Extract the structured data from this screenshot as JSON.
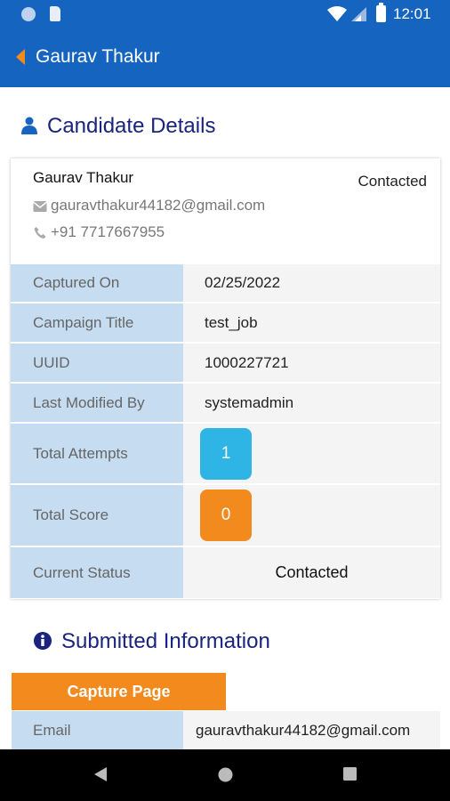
{
  "status_bar": {
    "time": "12:01"
  },
  "app_bar": {
    "title": "Gaurav Thakur",
    "back_icon": "back-arrow-icon",
    "accent_color": "#1565C0",
    "back_color": "#f28a1e"
  },
  "candidate_section": {
    "title": "Candidate Details",
    "icon": "user-icon",
    "name": "Gaurav Thakur",
    "status": "Contacted",
    "email": "gauravthakur44182@gmail.com",
    "phone": "+91 7717667955",
    "details": [
      {
        "label": "Captured On",
        "value": "02/25/2022"
      },
      {
        "label": "Campaign Title",
        "value": "test_job"
      },
      {
        "label": "UUID",
        "value": "1000227721"
      },
      {
        "label": "Last Modified By",
        "value": "systemadmin"
      },
      {
        "label": "Total Attempts",
        "value": "1"
      },
      {
        "label": "Total Score",
        "value": "0"
      },
      {
        "label": "Current Status",
        "value": "Contacted"
      }
    ]
  },
  "submitted_section": {
    "title": "Submitted Information",
    "icon": "info-icon",
    "tab_label": "Capture Page",
    "rows": [
      {
        "label": "Email",
        "value": "gauravthakur44182@gmail.com"
      }
    ]
  },
  "colors": {
    "header_blue": "#1565C0",
    "title_navy": "#1a237e",
    "label_bg": "#c6dcf0",
    "value_bg": "#f4f4f4",
    "badge_blue": "#2fb5e5",
    "badge_orange": "#f28a1e"
  }
}
